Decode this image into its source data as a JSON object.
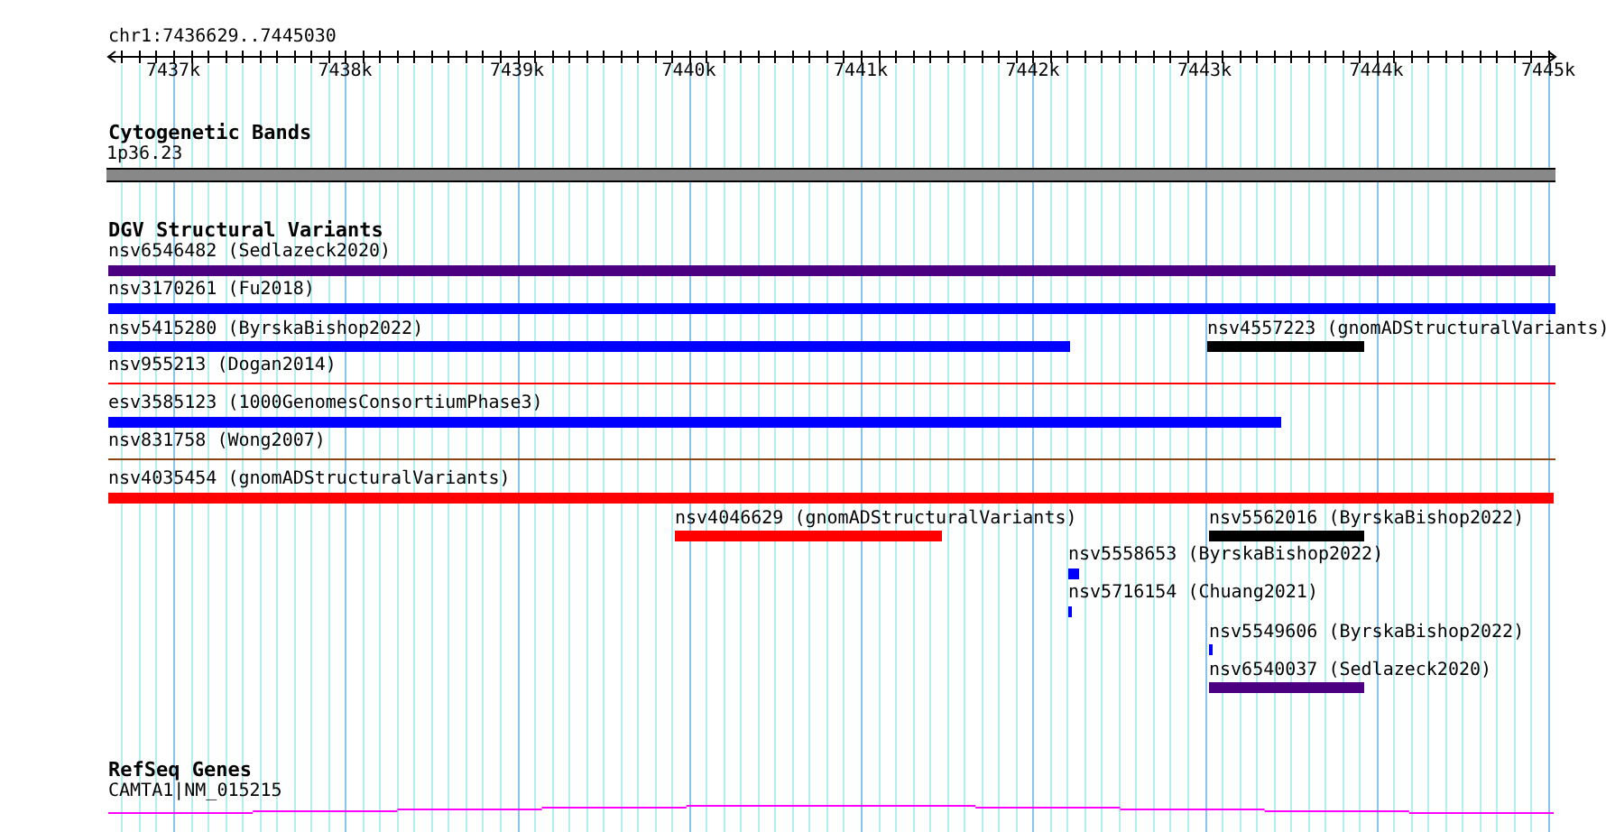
{
  "ruler": {
    "location": "chr1:7436629..7445030",
    "ticks": [
      "7437k",
      "7438k",
      "7439k",
      "7440k",
      "7441k",
      "7442k",
      "7443k",
      "7444k",
      "7445k"
    ]
  },
  "tracks": [
    {
      "title": "Cytogenetic Bands",
      "features": [
        {
          "label": "1p36.23",
          "kind": "band",
          "color": "#888888"
        }
      ]
    },
    {
      "title": "DGV Structural Variants",
      "features": [
        {
          "label": "nsv6546482 (Sedlazeck2020)",
          "kind": "bar",
          "color": "#4b0082"
        },
        {
          "label": "nsv3170261 (Fu2018)",
          "kind": "bar",
          "color": "#0000ff"
        },
        {
          "label": "nsv5415280 (ByrskaBishop2022)",
          "kind": "bar",
          "color": "#0000ff"
        },
        {
          "label": "nsv4557223 (gnomADStructuralVariants)",
          "kind": "bar",
          "color": "#000000"
        },
        {
          "label": "nsv955213 (Dogan2014)",
          "kind": "line",
          "color": "#ff0000"
        },
        {
          "label": "esv3585123 (1000GenomesConsortiumPhase3)",
          "kind": "bar",
          "color": "#0000ff"
        },
        {
          "label": "nsv831758 (Wong2007)",
          "kind": "line",
          "color": "#8b4513"
        },
        {
          "label": "nsv4035454 (gnomADStructuralVariants)",
          "kind": "bar",
          "color": "#ff0000"
        },
        {
          "label": "nsv4046629 (gnomADStructuralVariants)",
          "kind": "bar",
          "color": "#ff0000"
        },
        {
          "label": "nsv5562016 (ByrskaBishop2022)",
          "kind": "bar",
          "color": "#000000"
        },
        {
          "label": "nsv5558653 (ByrskaBishop2022)",
          "kind": "bar",
          "color": "#0000ff"
        },
        {
          "label": "nsv5716154 (Chuang2021)",
          "kind": "bar",
          "color": "#0000ff"
        },
        {
          "label": "nsv5549606 (ByrskaBishop2022)",
          "kind": "bar",
          "color": "#0000ff"
        },
        {
          "label": "nsv6540037 (Sedlazeck2020)",
          "kind": "bar",
          "color": "#4b0082"
        }
      ]
    },
    {
      "title": "RefSeq Genes",
      "features": [
        {
          "label": "CAMTA1|NM_015215",
          "kind": "gene",
          "color": "#ff00ff"
        }
      ]
    }
  ]
}
